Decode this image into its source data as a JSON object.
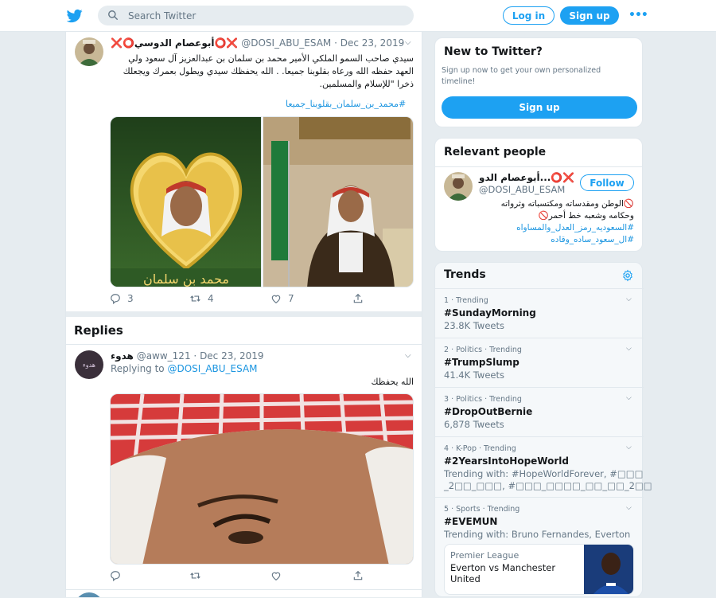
{
  "search": {
    "placeholder": "Search Twitter"
  },
  "header": {
    "login_label": "Log in",
    "signup_label": "Sign up",
    "more_label": "•••"
  },
  "tweet": {
    "display_name": "أبوعصام الدوسي",
    "name_prefix_marks": "❌⭕",
    "name_suffix_marks": "⭕❌",
    "handle": "@DOSI_ABU_ESAM",
    "separator": "·",
    "date": "Dec 23, 2019",
    "text_line1": "سيدي صاحب السمو الملكي الأمير محمد بن سلمان بن عبدالعزيز آل سعود ولي",
    "text_line2": "العهد حفظه الله ورعاه بقلوبنا جميعا. . الله يحفظك سيدي ويطول بعمرك ويجعلك",
    "text_line3": "ذخرا \"للإسلام والمسلمين.",
    "hashtag": "#محمد_بن_سلمان_بقلوبنا_جميعا",
    "replies": "3",
    "retweets": "4",
    "likes": "7",
    "image_caption": "محمد بن سلمان"
  },
  "replies_section": {
    "title": "Replies"
  },
  "reply": {
    "display_name": "هدوء",
    "handle": "@aww_121",
    "separator": "·",
    "date": "Dec 23, 2019",
    "replying_to_label": "Replying to",
    "replying_to_handle": "@DOSI_ABU_ESAM",
    "text": "الله يحفظك",
    "avatar_text": "هدوء"
  },
  "sidebar": {
    "new_to_twitter": {
      "title": "New to Twitter?",
      "description": "Sign up now to get your own personalized timeline!",
      "button": "Sign up"
    },
    "relevant_people": {
      "title": "Relevant people",
      "name": "أبوعصام الدو...",
      "name_marks": "⭕❌",
      "handle": "@DOSI_ABU_ESAM",
      "follow_label": "Follow",
      "bio_line1": "🚫الوطن ومقدساته ومكتسباته وثرواته",
      "bio_line2": "وحكامه وشعبه خط أحمر🚫",
      "bio_tag1": "#السعوديه_رمز_العدل_والمساواه",
      "bio_tag2": "#ال_سعود_ساده_وقاده"
    },
    "trends": {
      "title": "Trends",
      "items": [
        {
          "meta": "1 · Trending",
          "name": "#SundayMorning",
          "count": "23.8K Tweets"
        },
        {
          "meta": "2 · Politics · Trending",
          "name": "#TrumpSlump",
          "count": "41.4K Tweets"
        },
        {
          "meta": "3 · Politics · Trending",
          "name": "#DropOutBernie",
          "count": "6,878 Tweets"
        },
        {
          "meta": "4 · K-Pop · Trending",
          "name": "#2YearsIntoHopeWorld",
          "count": "Trending with: #HopeWorldForever, #□□□",
          "count2": "_2□□_□□□, #□□□_□□□□_□□_□□_2□□"
        },
        {
          "meta": "5 · Sports · Trending",
          "name": "#EVEMUN",
          "count": "Trending with: Bruno Fernandes, Everton"
        }
      ],
      "promo": {
        "league": "Premier League",
        "match": "Everton vs Manchester United"
      }
    }
  },
  "colors": {
    "accent": "#1da1f2",
    "background": "#e6ecf0",
    "link": "#1b95e0",
    "muted": "#657786"
  }
}
